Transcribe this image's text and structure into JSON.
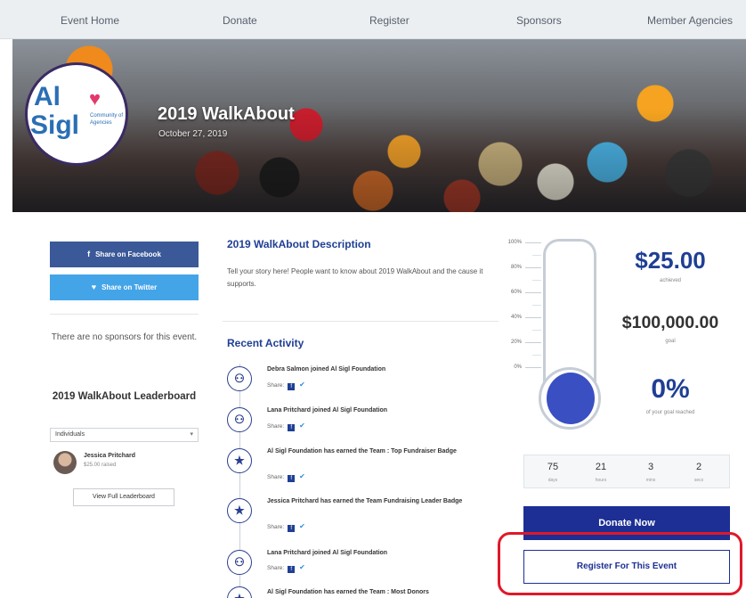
{
  "nav": {
    "items": [
      "Event Home",
      "Donate",
      "Register",
      "Sponsors",
      "Member Agencies"
    ]
  },
  "hero": {
    "logo_line1": "Al",
    "logo_line2": "Sigl",
    "logo_tagline": "Community of Agencies",
    "title": "2019 WalkAbout",
    "date": "October 27, 2019"
  },
  "social": {
    "facebook_label": "Share on Facebook",
    "twitter_label": "Share on Twitter"
  },
  "sponsors": {
    "empty_text": "There are no sponsors for this event."
  },
  "leaderboard": {
    "title": "2019 WalkAbout Leaderboard",
    "filter_value": "Individuals",
    "entries": [
      {
        "name": "Jessica Pritchard",
        "amount": "$25.00 raised"
      }
    ],
    "view_full_label": "View Full Leaderboard"
  },
  "description": {
    "title": "2019 WalkAbout Description",
    "text": "Tell your story here! People want to know about 2019 WalkAbout and the cause it supports."
  },
  "activity": {
    "title": "Recent Activity",
    "share_label": "Share:",
    "items": [
      {
        "icon": "user-join-icon",
        "text": "Debra Salmon joined Al Sigl Foundation"
      },
      {
        "icon": "user-join-icon",
        "text": "Lana Pritchard joined Al Sigl Foundation"
      },
      {
        "icon": "star-badge-icon",
        "text": "Al Sigl Foundation has earned the Team : Top Fundraiser Badge"
      },
      {
        "icon": "star-badge-icon",
        "text": "Jessica Pritchard has earned the Team Fundraising Leader Badge"
      },
      {
        "icon": "user-join-icon",
        "text": "Lana Pritchard joined Al Sigl Foundation"
      },
      {
        "icon": "star-badge-icon",
        "text": "Al Sigl Foundation has earned the Team : Most Donors"
      }
    ]
  },
  "thermometer": {
    "ticks": [
      "100%",
      "80%",
      "60%",
      "40%",
      "20%",
      "0%"
    ],
    "fill_percent": 0
  },
  "stats": {
    "achieved_amount": "$25.00",
    "achieved_label": "achieved",
    "goal_amount": "$100,000.00",
    "goal_label": "goal",
    "percent": "0%",
    "percent_label": "of your goal reached"
  },
  "countdown": {
    "units": [
      {
        "value": "75",
        "label": "days"
      },
      {
        "value": "21",
        "label": "hours"
      },
      {
        "value": "3",
        "label": "mins"
      },
      {
        "value": "2",
        "label": "secs"
      }
    ]
  },
  "actions": {
    "donate_label": "Donate Now",
    "register_label": "Register For This Event"
  },
  "colors": {
    "brand_blue": "#1d2f94",
    "facebook": "#3b5998",
    "twitter": "#44a4e8",
    "highlight": "#e0182a"
  }
}
